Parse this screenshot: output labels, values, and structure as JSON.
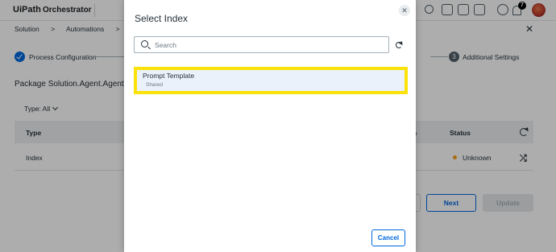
{
  "header": {
    "logo_text": "UiPath",
    "app_name": "Orchestrator",
    "notification_count": "7",
    "icons": [
      "search-icon",
      "add-icon",
      "grid-icon",
      "monitor-icon",
      "help-icon",
      "bell-icon",
      "avatar"
    ]
  },
  "breadcrumb": {
    "items": [
      "Solution",
      ">",
      "Automations",
      ">",
      "I"
    ],
    "close_icon": "close-icon"
  },
  "stepper": {
    "step1_label": "Process Configuration",
    "step3_number": "3",
    "step3_label": "Additional Settings"
  },
  "page": {
    "package_title": "Package Solution.Agent.Agent - Ve",
    "type_filter": "Type: All"
  },
  "table": {
    "col_type": "Type",
    "col_partial": "h",
    "col_status": "Status",
    "rows": [
      {
        "type": "Index",
        "status": "Unknown"
      }
    ]
  },
  "footer": {
    "next_label": "Next",
    "update_label": "Update"
  },
  "modal": {
    "title": "Select Index",
    "search_placeholder": "Search",
    "items": [
      {
        "title": "Prompt Template",
        "subtitle": "Shared"
      }
    ],
    "cancel_label": "Cancel"
  },
  "colors": {
    "accent": "#0067df",
    "highlight": "#fbe20a",
    "status_unknown": "#fa9f1c"
  }
}
